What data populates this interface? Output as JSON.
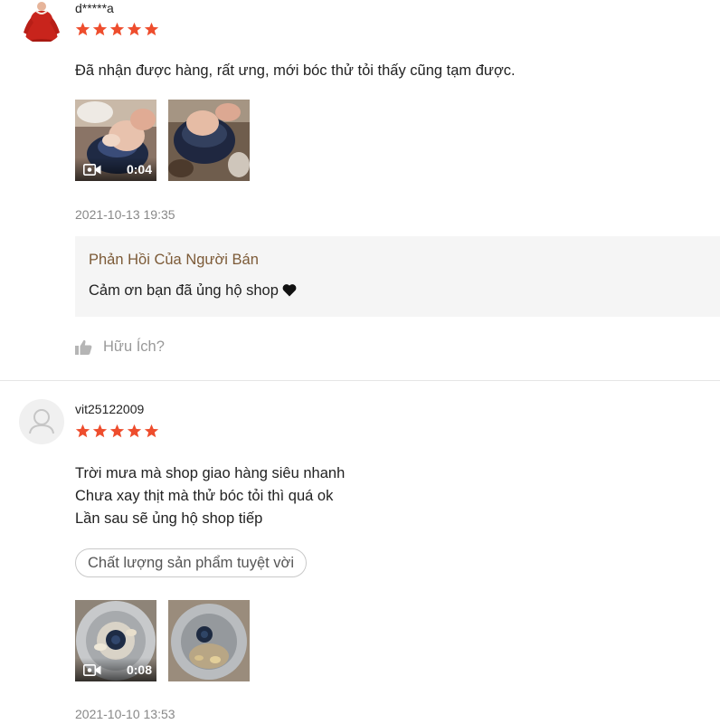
{
  "reviews": [
    {
      "username": "d*****a",
      "rating": 5,
      "comment_lines": [
        "Đã nhận được hàng, rất ưng, mới bóc thử tỏi thấy cũng tạm được."
      ],
      "media": [
        {
          "type": "video",
          "duration": "0:04"
        },
        {
          "type": "image"
        }
      ],
      "date": "2021-10-13 19:35",
      "seller_reply": {
        "title": "Phản Hồi Của Người Bán",
        "text": "Cảm ơn bạn đã ủng hộ shop"
      },
      "helpful_label": "Hữu Ích?"
    },
    {
      "username": "vit25122009",
      "rating": 5,
      "comment_lines": [
        "Trời mưa mà shop giao hàng siêu nhanh",
        "Chưa xay thịt mà thử bóc tỏi thì quá ok",
        "Lần sau sẽ ủng hộ shop tiếp"
      ],
      "tag": "Chất lượng sản phẩm tuyệt vời",
      "media": [
        {
          "type": "video",
          "duration": "0:08"
        },
        {
          "type": "image"
        }
      ],
      "date": "2021-10-10 13:53"
    }
  ],
  "colors": {
    "star": "#ee4d2d",
    "reply_title": "#7c5a37",
    "reply_background": "#f5f5f5",
    "muted_text": "#888888"
  },
  "icons": {
    "star": "star-icon",
    "video": "video-camera-icon",
    "heart": "heart-icon",
    "like": "thumbs-up-icon",
    "default_avatar": "user-silhouette-icon"
  }
}
